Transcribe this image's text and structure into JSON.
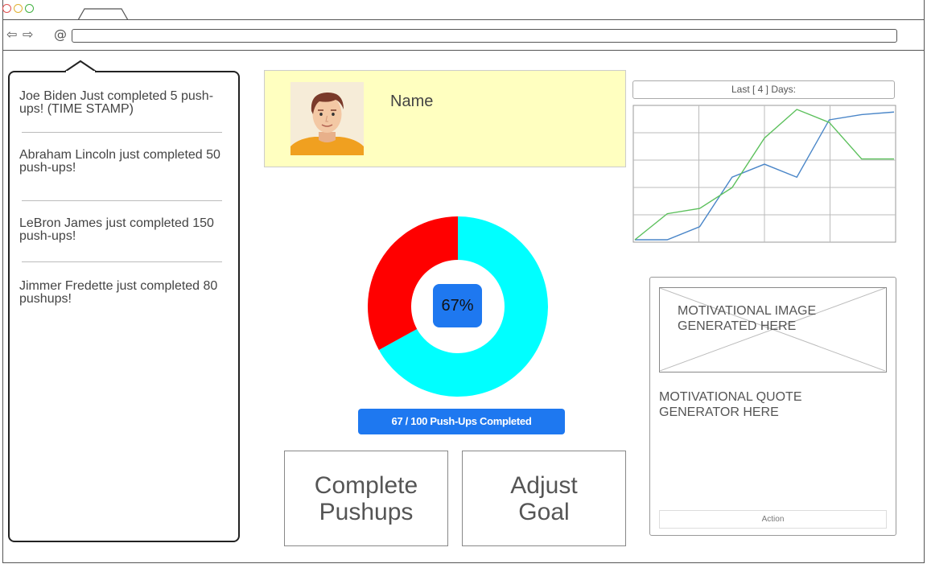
{
  "feed": {
    "items": [
      {
        "text": "Joe Biden Just completed 5 push-ups! (TIME STAMP)"
      },
      {
        "text": "Abraham Lincoln just completed 50 push-ups!"
      },
      {
        "text": "LeBron James just completed 150 push-ups!"
      },
      {
        "text": "Jimmer Fredette just completed 80 pushups!"
      }
    ]
  },
  "profile": {
    "name": "Name"
  },
  "trend_chart": {
    "header": "Last  [  4 ] Days:",
    "colors": {
      "blue": "#4a86c8",
      "green": "#5cc05c",
      "grid": "#bbbbbb"
    }
  },
  "progress": {
    "percent_label": "67%",
    "completed": 67,
    "goal": 100,
    "summary_label": "67 / 100 Push-Ups Completed",
    "colors": {
      "done": "#00ffff",
      "remaining": "#ff0000",
      "center": "#1e78f0"
    }
  },
  "buttons": {
    "complete": "Complete\nPushups",
    "adjust": "Adjust\nGoal"
  },
  "motivation": {
    "image_caption": "MOTIVATIONAL IMAGE GENERATED HERE",
    "quote_caption": "MOTIVATIONAL QUOTE GENERATOR HERE",
    "action_label": "Action"
  },
  "chart_data": {
    "type": "line",
    "title": "Last  [  4 ] Days:",
    "x": [
      0,
      1,
      2,
      3,
      4,
      5,
      6,
      7,
      8
    ],
    "series": [
      {
        "values": [
          0,
          0,
          10,
          48,
          58,
          48,
          92,
          96,
          98
        ],
        "color": "#4a86c8"
      },
      {
        "values": [
          0,
          20,
          24,
          40,
          78,
          100,
          90,
          62,
          62
        ],
        "color": "#5cc05c"
      }
    ],
    "ylim": [
      0,
      100
    ],
    "grid": true
  }
}
